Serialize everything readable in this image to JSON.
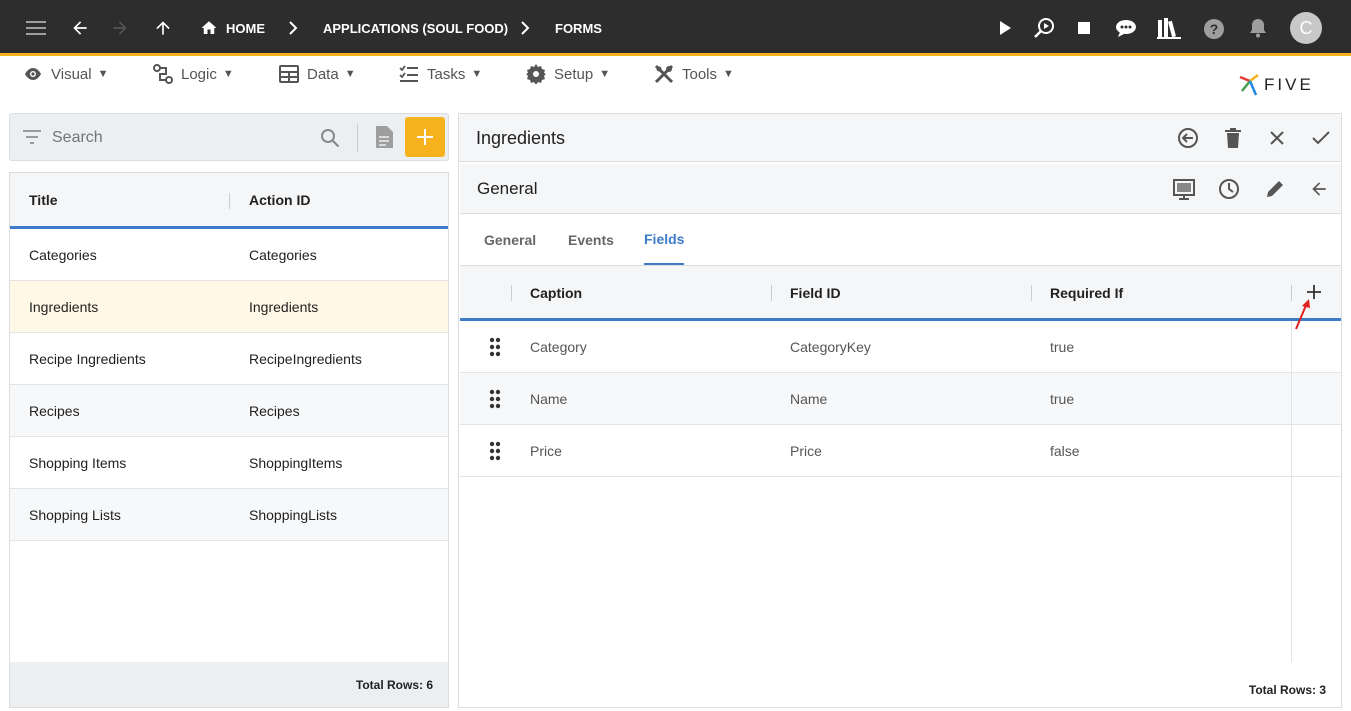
{
  "topbar": {
    "breadcrumbs": {
      "home": "HOME",
      "app": "APPLICATIONS (SOUL FOOD)",
      "forms": "FORMS"
    },
    "avatar_initial": "C"
  },
  "menu": {
    "visual": "Visual",
    "logic": "Logic",
    "data": "Data",
    "tasks": "Tasks",
    "setup": "Setup",
    "tools": "Tools"
  },
  "brand": {
    "logo_text": "FIVE"
  },
  "left": {
    "search_placeholder": "Search",
    "columns": {
      "title": "Title",
      "action_id": "Action ID"
    },
    "rows": [
      {
        "title": "Categories",
        "action_id": "Categories"
      },
      {
        "title": "Ingredients",
        "action_id": "Ingredients"
      },
      {
        "title": "Recipe Ingredients",
        "action_id": "RecipeIngredients"
      },
      {
        "title": "Recipes",
        "action_id": "Recipes"
      },
      {
        "title": "Shopping Items",
        "action_id": "ShoppingItems"
      },
      {
        "title": "Shopping Lists",
        "action_id": "ShoppingLists"
      }
    ],
    "selected_index": 1,
    "total_rows": "Total Rows: 6"
  },
  "right": {
    "title": "Ingredients",
    "subtitle": "General",
    "tabs": [
      "General",
      "Events",
      "Fields"
    ],
    "active_tab": "Fields",
    "columns": {
      "caption": "Caption",
      "field_id": "Field ID",
      "required_if": "Required If"
    },
    "rows": [
      {
        "caption": "Category",
        "field_id": "CategoryKey",
        "required_if": "true"
      },
      {
        "caption": "Name",
        "field_id": "Name",
        "required_if": "true"
      },
      {
        "caption": "Price",
        "field_id": "Price",
        "required_if": "false"
      }
    ],
    "total_rows": "Total Rows: 3"
  },
  "colors": {
    "accent": "#f5b21c",
    "primary": "#3d7cc9",
    "topbar": "#2d2d2d",
    "selected_row": "#fff8e6",
    "annotation_arrow": "#e02020"
  }
}
